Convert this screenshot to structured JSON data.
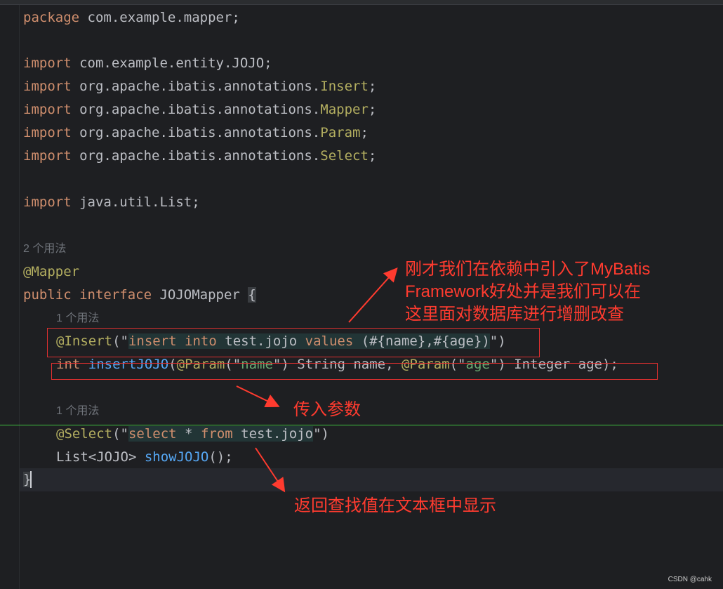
{
  "code": {
    "l1": {
      "kw": "package",
      "rest": " com.example.mapper;"
    },
    "l2": {
      "kw": "import",
      "rest": " com.example.entity.JOJO;"
    },
    "l3": {
      "kw": "import",
      "rest": " org.apache.ibatis.annotations.",
      "ann": "Insert",
      "end": ";"
    },
    "l4": {
      "kw": "import",
      "rest": " org.apache.ibatis.annotations.",
      "ann": "Mapper",
      "end": ";"
    },
    "l5": {
      "kw": "import",
      "rest": " org.apache.ibatis.annotations.",
      "ann": "Param",
      "end": ";"
    },
    "l6": {
      "kw": "import",
      "rest": " org.apache.ibatis.annotations.",
      "ann": "Select",
      "end": ";"
    },
    "l7": {
      "kw": "import",
      "rest": " java.util.List;"
    },
    "hint_class": "2 个用法",
    "l8": {
      "ann": "@Mapper"
    },
    "l9": {
      "kw1": "public",
      "kw2": "interface",
      "name": " JOJOMapper ",
      "brace": "{"
    },
    "hint_insert": "1 个用法",
    "l10": {
      "ann": "@Insert",
      "open": "(\"",
      "sql1": "insert into",
      "sql2": " test.jojo ",
      "sql3": "values",
      "sql4": " (#{name},#{age})",
      "close": "\")"
    },
    "l11": {
      "kw": "int",
      "fn": "insertJOJO",
      "p1": "(",
      "a1": "@Param",
      "s1": "(\"",
      "s1v": "name",
      "s1e": "\")",
      "t1": " String name, ",
      "a2": "@Param",
      "s2": "(\"",
      "s2v": "age",
      "s2e": "\")",
      "t2": " Integer age);"
    },
    "hint_select": "1 个用法",
    "l12": {
      "ann": "@Select",
      "open": "(\"",
      "sql1": "select",
      "sql2": " * ",
      "sql3": "from",
      "sql4": " test.jojo",
      "close": "\")"
    },
    "l13": {
      "t1": "List<JOJO> ",
      "fn": "showJOJO",
      "t2": "();"
    },
    "l14": {
      "brace": "}"
    }
  },
  "annotations": {
    "note1": "刚才我们在依赖中引入了MyBatis\nFramework好处并是我们可以在\n这里面对数据库进行增删改查",
    "note2": "传入参数",
    "note3": "返回查找值在文本框中显示"
  },
  "watermark": "CSDN @cahk",
  "colors": {
    "keyword": "#cf8e6d",
    "annotation": "#b3ae60",
    "string": "#6aab73",
    "function": "#56a8f5",
    "note": "#ff3b2f"
  }
}
